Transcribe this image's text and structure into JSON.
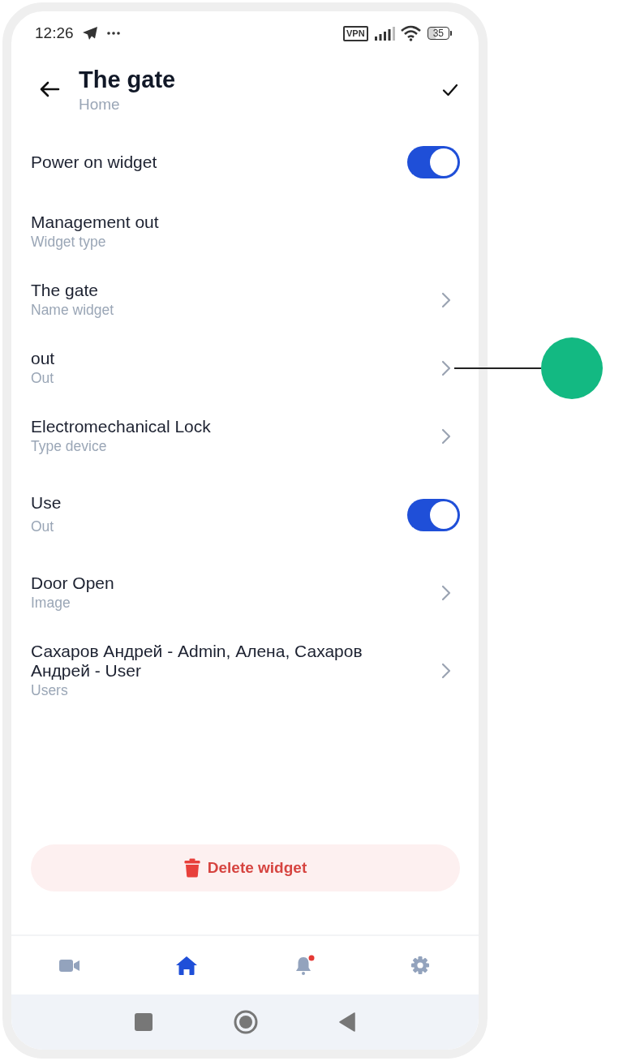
{
  "status_bar": {
    "time": "12:26",
    "vpn": "VPN",
    "battery": "35"
  },
  "header": {
    "title": "The gate",
    "subtitle": "Home"
  },
  "rows": [
    {
      "kind": "toggle",
      "title": "Power on widget",
      "on": true,
      "callout": false
    },
    {
      "kind": "info",
      "title": "Management out",
      "subtitle": "Widget type",
      "callout": false
    },
    {
      "kind": "link",
      "title": "The gate",
      "subtitle": "Name widget",
      "callout": false
    },
    {
      "kind": "link",
      "title": "out",
      "subtitle": "Out",
      "callout": true
    },
    {
      "kind": "link",
      "title": "Electromechanical Lock",
      "subtitle": "Type device",
      "callout": false
    },
    {
      "kind": "toggle",
      "title": "Use",
      "subtitle": "Out",
      "on": true,
      "callout": false
    },
    {
      "kind": "link",
      "title": "Door Open",
      "subtitle": "Image",
      "callout": false
    },
    {
      "kind": "link",
      "title": "Сахаров Андрей - Admin, Алена, Сахаров Андрей - User",
      "subtitle": "Users",
      "callout": false
    }
  ],
  "delete_button": {
    "label": "Delete widget"
  },
  "nav": [
    {
      "selected": false,
      "badge": false
    },
    {
      "selected": true,
      "badge": false
    },
    {
      "selected": false,
      "badge": true
    },
    {
      "selected": false,
      "badge": false
    }
  ]
}
